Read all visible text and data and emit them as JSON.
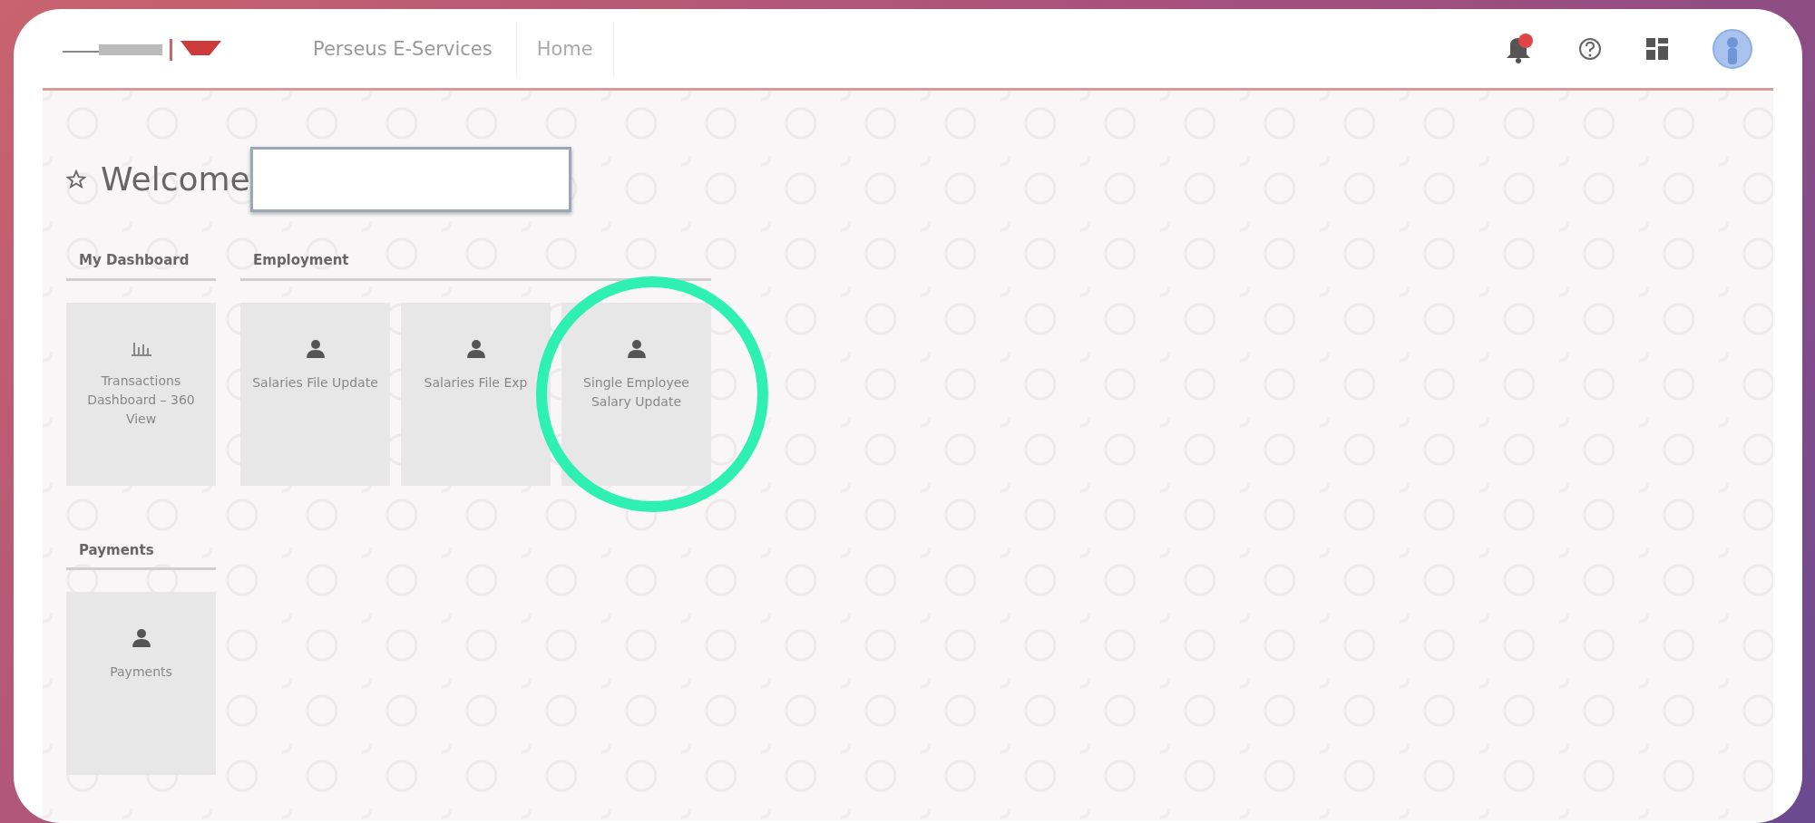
{
  "header": {
    "app_title": "Perseus E-Services",
    "nav": [
      {
        "label": "Home"
      }
    ],
    "notifications": {
      "unread": true
    }
  },
  "welcome": {
    "title": "Welcome"
  },
  "section_rows": [
    {
      "sections": [
        {
          "title": "My Dashboard",
          "tiles": [
            {
              "kind": "chart",
              "label": "Transactions Dashboard – 360 View",
              "highlighted": false
            }
          ]
        },
        {
          "title": "Employment",
          "tiles": [
            {
              "kind": "person",
              "label": "Salaries File Update",
              "highlighted": false
            },
            {
              "kind": "person",
              "label": "Salaries File Exp",
              "highlighted": false
            },
            {
              "kind": "person",
              "label": "Single Employee Salary Update",
              "highlighted": true
            }
          ]
        }
      ]
    },
    {
      "sections": [
        {
          "title": "Payments",
          "tiles": [
            {
              "kind": "person",
              "label": "Payments",
              "highlighted": false
            }
          ]
        }
      ]
    }
  ]
}
